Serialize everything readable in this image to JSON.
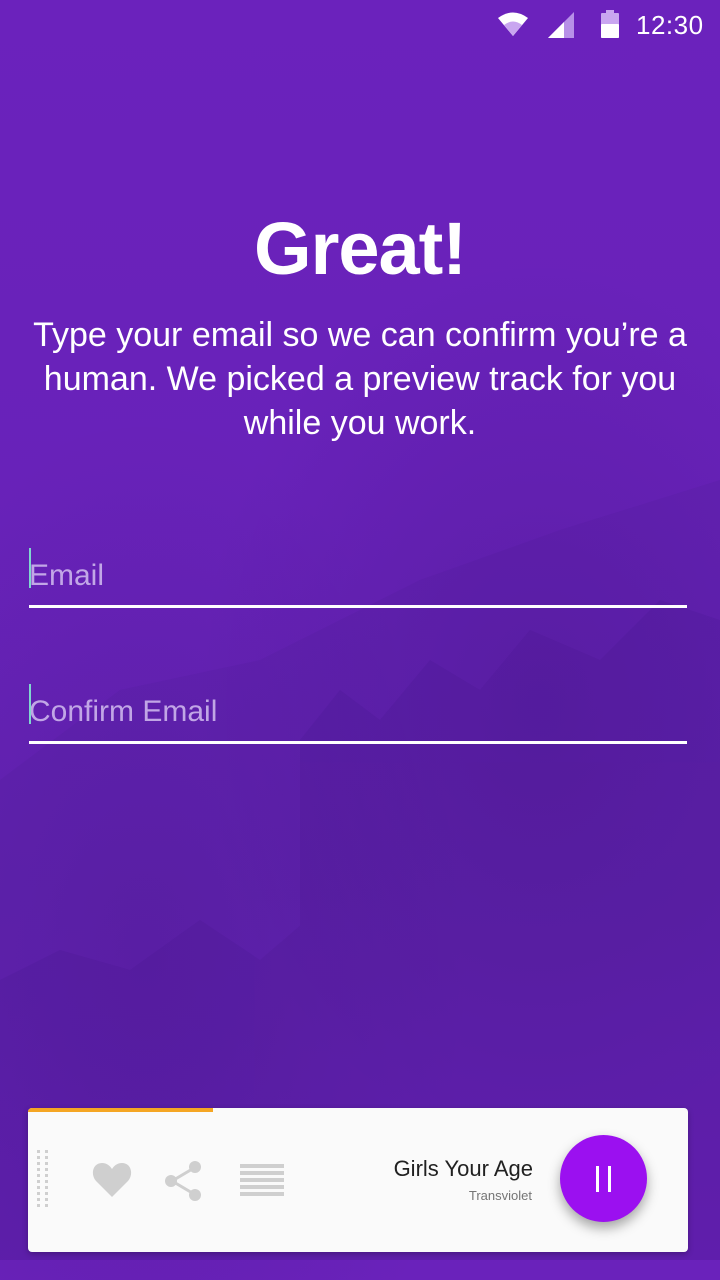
{
  "status_bar": {
    "time": "12:30",
    "icons": [
      "wifi-icon",
      "cell-signal-icon",
      "battery-icon"
    ]
  },
  "onboarding": {
    "headline": "Great!",
    "description": "Type your email so we can confirm you’re a human. We picked a preview track for you while you work."
  },
  "form": {
    "email": {
      "placeholder": "Email",
      "value": ""
    },
    "confirm_email": {
      "placeholder": "Confirm Email",
      "value": ""
    }
  },
  "player": {
    "track_title": "Girls Your Age",
    "artist": "Transviolet",
    "progress": 0.28,
    "actions": [
      "heart-icon",
      "share-icon",
      "queue-icon"
    ],
    "play_state_icon": "pause-icon"
  },
  "colors": {
    "background": "#6a22bb",
    "accent": "#9b10f0",
    "progress": "#f5a623",
    "cursor": "#7fd6cf"
  }
}
